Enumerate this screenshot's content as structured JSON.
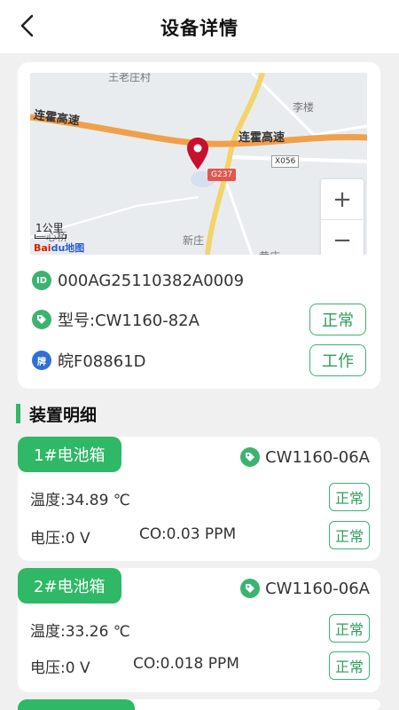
{
  "header": {
    "title": "设备详情"
  },
  "map": {
    "labels": {
      "top_village": "王老庄村",
      "highway_left": "连霍高速",
      "highway_right": "连霍高速",
      "li_lou": "李楼",
      "x056": "X056",
      "g237": "G237",
      "xin_zhuang": "新庄",
      "bridge": "一心桥",
      "bottom": "黄庄"
    },
    "scale": "1公里",
    "logo_bai": "Bai",
    "logo_du": "du地图",
    "zoom_in": "+",
    "zoom_out": "−"
  },
  "device": {
    "id": "000AG25110382A0009",
    "model": "型号:CW1160-82A",
    "plate": "皖F08861D",
    "status_label": "正常",
    "work_label": "工作",
    "icon_id_text": "ID",
    "icon_plate_text": "牌"
  },
  "section": {
    "title": "装置明细"
  },
  "boxes": [
    {
      "name": "1#电池箱",
      "model": "CW1160-06A",
      "temp": "温度:34.89 ℃",
      "voltage": "电压:0 V",
      "co": "CO:0.03 PPM",
      "status_1": "正常",
      "status_2": "正常"
    },
    {
      "name": "2#电池箱",
      "model": "CW1160-06A",
      "temp": "温度:33.26 ℃",
      "voltage": "电压:0 V",
      "co": "CO:0.018 PPM",
      "status_1": "正常",
      "status_2": "正常"
    }
  ],
  "colors": {
    "accent": "#2fb866",
    "accent_border": "#3cb371",
    "map_pin": "#c8102e",
    "highway": "#f0a04b"
  }
}
